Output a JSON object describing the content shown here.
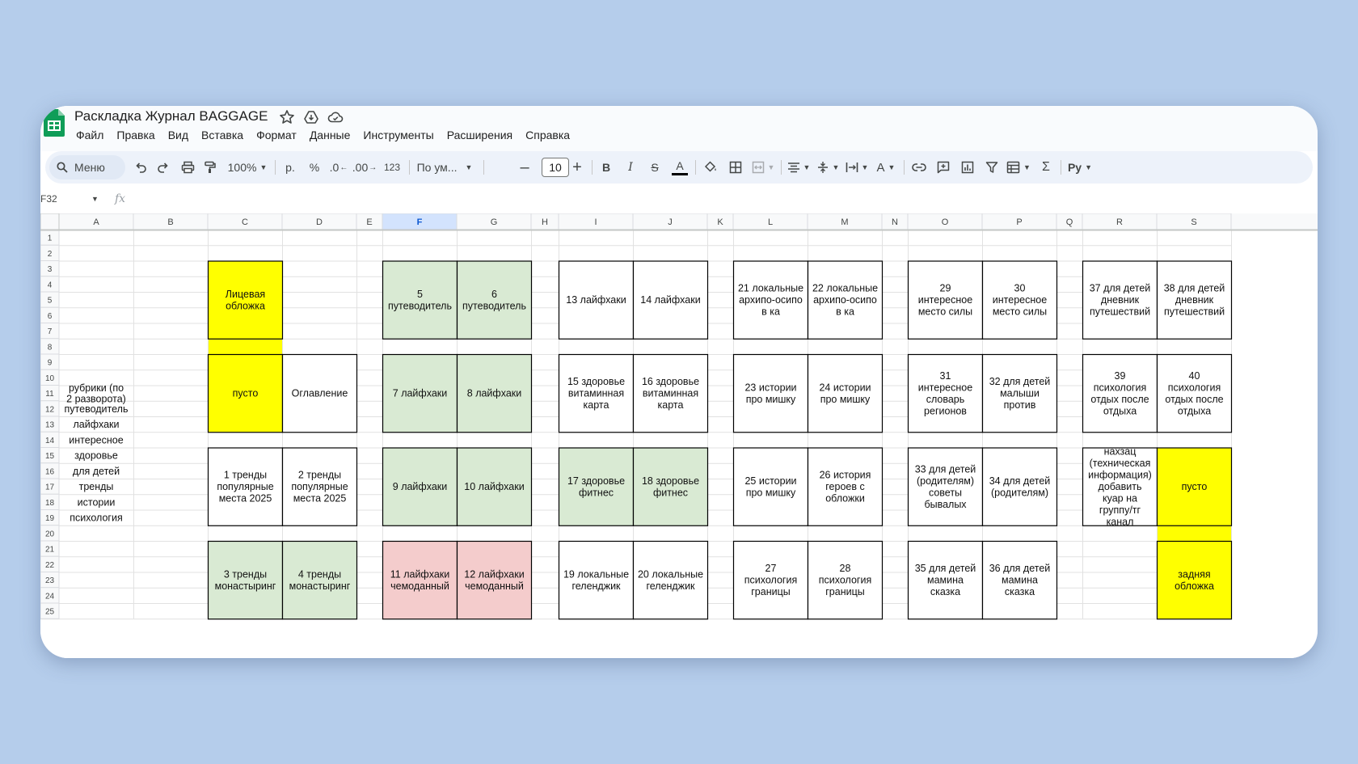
{
  "app": {
    "title": "Раскладка Журнал BAGGAGE",
    "menu": [
      "Файл",
      "Правка",
      "Вид",
      "Вставка",
      "Формат",
      "Данные",
      "Инструменты",
      "Расширения",
      "Справка"
    ]
  },
  "toolbar": {
    "search_label": "Меню",
    "zoom": "100%",
    "currency": "р.",
    "percent": "%",
    "decrease_decimal": ".0",
    "increase_decimal": ".00",
    "number_format": "123",
    "font_name": "По ум...",
    "font_size": "10",
    "bold": "B",
    "italic": "I",
    "strike": "S",
    "text_color_letter": "A",
    "text_color_bar": "#000000",
    "text_rotation": "A",
    "input_tools": "Py",
    "sum": "Σ"
  },
  "formula_bar": {
    "cell_ref": "F32",
    "fx": "fx"
  },
  "grid": {
    "columns": [
      "A",
      "B",
      "C",
      "D",
      "E",
      "F",
      "G",
      "H",
      "I",
      "J",
      "K",
      "L",
      "M",
      "N",
      "O",
      "P",
      "Q",
      "R",
      "S"
    ],
    "selected_column": "F",
    "rows": [
      "1",
      "2",
      "3",
      "4",
      "5",
      "6",
      "7",
      "8",
      "9",
      "10",
      "11",
      "12",
      "13",
      "14",
      "15",
      "16",
      "17",
      "18",
      "19",
      "20",
      "21",
      "22",
      "23",
      "24",
      "25"
    ],
    "colors": {
      "yellow": "#ffff00",
      "green": "#d9ead3",
      "pink": "#f4cccc",
      "header_selected": "#d3e3fd"
    },
    "rubrics": [
      {
        "row": 11,
        "text": "рубрики (по 2 разворота)"
      },
      {
        "row": 12,
        "text": "путеводитель"
      },
      {
        "row": 13,
        "text": "лайфхаки"
      },
      {
        "row": 14,
        "text": "интересное"
      },
      {
        "row": 15,
        "text": "здоровье"
      },
      {
        "row": 16,
        "text": "для детей"
      },
      {
        "row": 17,
        "text": "тренды"
      },
      {
        "row": 18,
        "text": "истории"
      },
      {
        "row": 19,
        "text": "психология"
      }
    ],
    "pages": [
      {
        "col": "C",
        "r1": 3,
        "r2": 7,
        "text": "Лицевая обложка",
        "fill": "yellow"
      },
      {
        "col": "F",
        "r1": 3,
        "r2": 7,
        "text": "5 путеводитель",
        "fill": "green"
      },
      {
        "col": "G",
        "r1": 3,
        "r2": 7,
        "text": "6 путеводитель",
        "fill": "green"
      },
      {
        "col": "I",
        "r1": 3,
        "r2": 7,
        "text": "13 лайфхаки",
        "fill": ""
      },
      {
        "col": "J",
        "r1": 3,
        "r2": 7,
        "text": "14 лайфхаки",
        "fill": ""
      },
      {
        "col": "L",
        "r1": 3,
        "r2": 7,
        "text": "21 локальные архипо-осипов ка",
        "fill": ""
      },
      {
        "col": "M",
        "r1": 3,
        "r2": 7,
        "text": "22 локальные архипо-осипов ка",
        "fill": ""
      },
      {
        "col": "O",
        "r1": 3,
        "r2": 7,
        "text": "29 интересное место силы",
        "fill": ""
      },
      {
        "col": "P",
        "r1": 3,
        "r2": 7,
        "text": "30 интересное место силы",
        "fill": ""
      },
      {
        "col": "R",
        "r1": 3,
        "r2": 7,
        "text": "37 для детей дневник путешествий",
        "fill": ""
      },
      {
        "col": "S",
        "r1": 3,
        "r2": 7,
        "text": "38 для детей дневник путешествий",
        "fill": ""
      },
      {
        "col": "C",
        "r1": 9,
        "r2": 13,
        "text": "пусто",
        "fill": "yellow"
      },
      {
        "col": "D",
        "r1": 9,
        "r2": 13,
        "text": "Оглавление",
        "fill": ""
      },
      {
        "col": "F",
        "r1": 9,
        "r2": 13,
        "text": "7 лайфхаки",
        "fill": "green"
      },
      {
        "col": "G",
        "r1": 9,
        "r2": 13,
        "text": "8 лайфхаки",
        "fill": "green"
      },
      {
        "col": "I",
        "r1": 9,
        "r2": 13,
        "text": "15 здоровье витаминная карта",
        "fill": ""
      },
      {
        "col": "J",
        "r1": 9,
        "r2": 13,
        "text": "16 здоровье витаминная карта",
        "fill": ""
      },
      {
        "col": "L",
        "r1": 9,
        "r2": 13,
        "text": "23 истории про мишку",
        "fill": ""
      },
      {
        "col": "M",
        "r1": 9,
        "r2": 13,
        "text": "24 истории про мишку",
        "fill": ""
      },
      {
        "col": "O",
        "r1": 9,
        "r2": 13,
        "text": "31 интересное словарь регионов",
        "fill": ""
      },
      {
        "col": "P",
        "r1": 9,
        "r2": 13,
        "text": "32 для детей малыши против",
        "fill": ""
      },
      {
        "col": "R",
        "r1": 9,
        "r2": 13,
        "text": "39 психология отдых после отдыха",
        "fill": ""
      },
      {
        "col": "S",
        "r1": 9,
        "r2": 13,
        "text": "40 психология отдых после отдыха",
        "fill": ""
      },
      {
        "col": "C",
        "r1": 15,
        "r2": 19,
        "text": "1 тренды популярные места 2025",
        "fill": ""
      },
      {
        "col": "D",
        "r1": 15,
        "r2": 19,
        "text": "2 тренды популярные места 2025",
        "fill": ""
      },
      {
        "col": "F",
        "r1": 15,
        "r2": 19,
        "text": "9 лайфхаки",
        "fill": "green"
      },
      {
        "col": "G",
        "r1": 15,
        "r2": 19,
        "text": "10 лайфхаки",
        "fill": "green"
      },
      {
        "col": "I",
        "r1": 15,
        "r2": 19,
        "text": "17 здоровье фитнес",
        "fill": "green"
      },
      {
        "col": "J",
        "r1": 15,
        "r2": 19,
        "text": "18 здоровье фитнес",
        "fill": "green"
      },
      {
        "col": "L",
        "r1": 15,
        "r2": 19,
        "text": "25 истории про мишку",
        "fill": ""
      },
      {
        "col": "M",
        "r1": 15,
        "r2": 19,
        "text": "26 история героев с обложки",
        "fill": ""
      },
      {
        "col": "O",
        "r1": 15,
        "r2": 19,
        "text": "33 для детей (родителям) советы бывалых",
        "fill": ""
      },
      {
        "col": "P",
        "r1": 15,
        "r2": 19,
        "text": "34 для детей (родителям)",
        "fill": ""
      },
      {
        "col": "R",
        "r1": 15,
        "r2": 19,
        "text": "нахзац (техническая информация) добавить куар на группу/тг канал",
        "fill": ""
      },
      {
        "col": "S",
        "r1": 15,
        "r2": 19,
        "text": "пусто",
        "fill": "yellow"
      },
      {
        "col": "C",
        "r1": 21,
        "r2": 25,
        "text": "3 тренды монастыринг",
        "fill": "green"
      },
      {
        "col": "D",
        "r1": 21,
        "r2": 25,
        "text": "4 тренды монастыринг",
        "fill": "green"
      },
      {
        "col": "F",
        "r1": 21,
        "r2": 25,
        "text": "11 лайфхаки чемоданный",
        "fill": "pink"
      },
      {
        "col": "G",
        "r1": 21,
        "r2": 25,
        "text": "12 лайфхаки чемоданный",
        "fill": "pink"
      },
      {
        "col": "I",
        "r1": 21,
        "r2": 25,
        "text": "19 локальные геленджик",
        "fill": ""
      },
      {
        "col": "J",
        "r1": 21,
        "r2": 25,
        "text": "20 локальные геленджик",
        "fill": ""
      },
      {
        "col": "L",
        "r1": 21,
        "r2": 25,
        "text": "27 психология границы",
        "fill": ""
      },
      {
        "col": "M",
        "r1": 21,
        "r2": 25,
        "text": "28 психология границы",
        "fill": ""
      },
      {
        "col": "O",
        "r1": 21,
        "r2": 25,
        "text": "35 для детей мамина сказка",
        "fill": ""
      },
      {
        "col": "P",
        "r1": 21,
        "r2": 25,
        "text": "36 для детей мамина сказка",
        "fill": ""
      },
      {
        "col": "S",
        "r1": 21,
        "r2": 25,
        "text": "задняя обложка",
        "fill": "yellow"
      }
    ],
    "fills": [
      {
        "col": "C",
        "row": 8,
        "fill": "yellow"
      },
      {
        "col": "S",
        "row": 20,
        "fill": "yellow"
      }
    ]
  }
}
